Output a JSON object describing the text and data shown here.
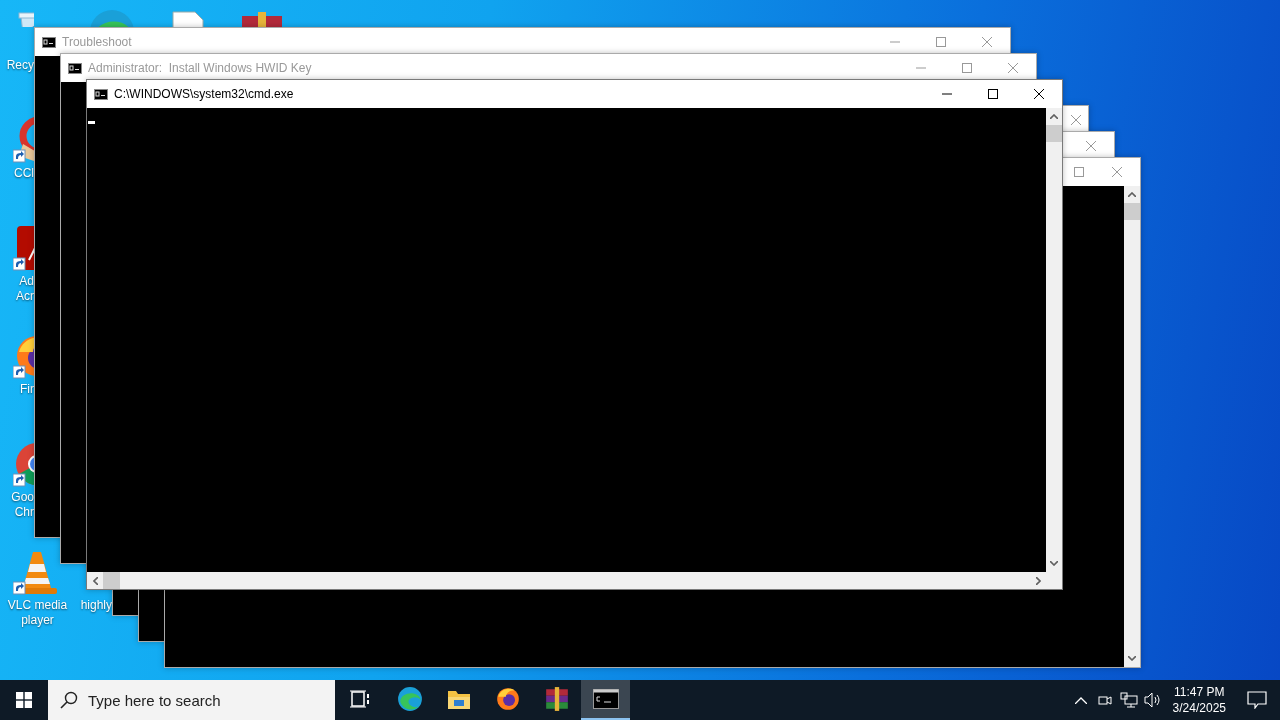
{
  "desktop_icons": [
    {
      "kind": "recycle-bin",
      "label": [
        "Recy"
      ]
    },
    {
      "kind": "edge"
    },
    {
      "kind": "document"
    },
    {
      "kind": "winrar"
    },
    {
      "kind": "ccleaner",
      "label": [
        "CCl"
      ],
      "shortcut": true
    },
    {
      "kind": "acrobat",
      "label": [
        "Ad",
        "Acr"
      ],
      "shortcut": true
    },
    {
      "kind": "firefox",
      "label": [
        "Fir"
      ],
      "shortcut": true
    },
    {
      "kind": "chrome",
      "label": [
        "Goo",
        "Chr"
      ],
      "shortcut": true
    },
    {
      "kind": "vlc",
      "label": [
        "VLC media",
        "player"
      ],
      "shortcut": true
    },
    {
      "kind": "hidden",
      "label": [
        "highly"
      ]
    }
  ],
  "windows": [
    {
      "title": "Troubleshoot",
      "active": false,
      "controls": [
        {
          "kind": "minimize"
        },
        {
          "kind": "maximize"
        },
        {
          "kind": "close"
        }
      ]
    },
    {
      "title": "Administrator:  Install Windows HWID Key",
      "active": false,
      "controls": [
        {
          "kind": "minimize"
        },
        {
          "kind": "maximize"
        },
        {
          "kind": "close"
        }
      ]
    },
    {
      "title": "C:\\WINDOWS\\system32\\cmd.exe",
      "active": true,
      "controls": [
        {
          "kind": "minimize"
        },
        {
          "kind": "maximize"
        },
        {
          "kind": "close"
        }
      ],
      "scrollbars": [
        {
          "kind": "vertical"
        },
        {
          "kind": "horizontal"
        }
      ],
      "cursor": true
    },
    {
      "active": false,
      "controls": [
        {
          "kind": "close"
        }
      ]
    },
    {
      "active": false,
      "controls": [
        {
          "kind": "close"
        }
      ]
    },
    {
      "active": false,
      "controls": [
        {
          "kind": "maximize"
        },
        {
          "kind": "close"
        }
      ],
      "scrollbars": [
        {
          "kind": "vertical"
        }
      ]
    }
  ],
  "taskbar": {
    "search": {
      "placeholder": "Type here to search"
    },
    "apps": [
      {
        "kind": "task-view",
        "selected": false
      },
      {
        "kind": "edge",
        "selected": false
      },
      {
        "kind": "explorer",
        "selected": false
      },
      {
        "kind": "firefox",
        "selected": false
      },
      {
        "kind": "winrar",
        "selected": false
      },
      {
        "kind": "cmd",
        "selected": true
      }
    ],
    "clock": {
      "time": "11:47 PM",
      "date": "3/24/2025"
    }
  }
}
